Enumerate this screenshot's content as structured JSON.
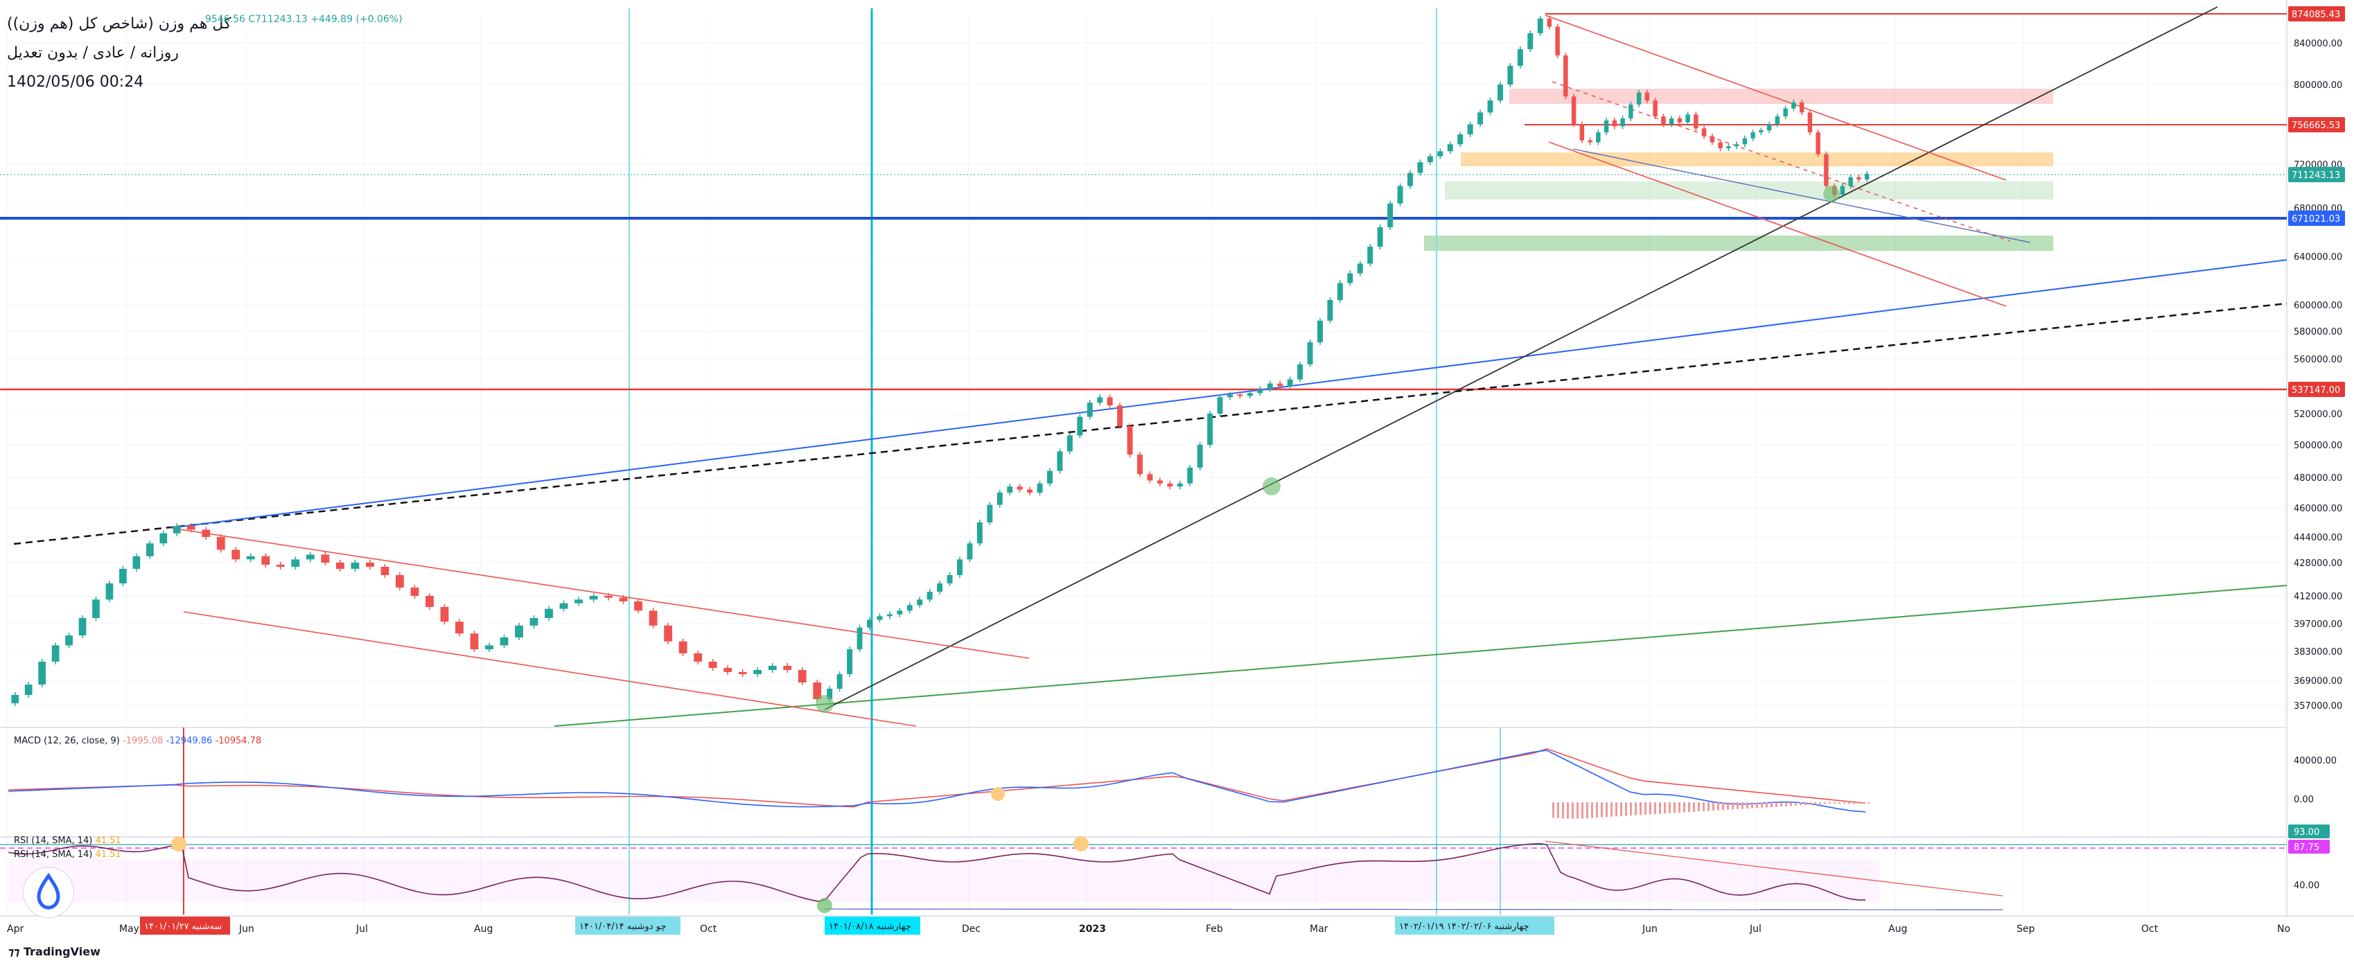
{
  "header": {
    "title": "کل هم وزن (شاخص کل (هم وزن))",
    "subtitle": "روزانه / عادی / بدون تعدیل",
    "datetime": "1402/05/06 00:24",
    "ohlc": "9546.56  C711243.13  +449.89 (+0.06%)"
  },
  "indicators": {
    "macd_label": "MACD (12, 26, close, 9)",
    "macd_v1": "-1995.08",
    "macd_v2": "-12949.86",
    "macd_v3": "-10954.78",
    "rsi1_label": "RSI (14, SMA, 14)",
    "rsi1_value": "41.51",
    "rsi2_label": "RSI (14, SMA, 14)",
    "rsi2_value": "41.51"
  },
  "brand": "TradingView",
  "colors": {
    "up": "#26a69a",
    "down": "#ef5350",
    "blue_line": "#2962ff",
    "red_line": "#e53935",
    "green_line": "#43a047",
    "cyan_line": "#00bcd4"
  },
  "chart_data": {
    "type": "candlestick",
    "title": "کل هم وزن (شاخص کل (هم وزن))",
    "x_tick_labels": [
      "Apr",
      "May",
      "Jun",
      "Jul",
      "Aug",
      "Oct",
      "Dec",
      "2023",
      "Feb",
      "Mar",
      "Jun",
      "Jul",
      "Aug",
      "Sep",
      "Oct",
      "No"
    ],
    "y_tick_labels": [
      "840000.00",
      "800000.00",
      "720000.00",
      "680000.00",
      "640000.00",
      "600000.00",
      "580000.00",
      "560000.00",
      "520000.00",
      "500000.00",
      "480000.00",
      "460000.00",
      "444000.00",
      "428000.00",
      "412000.00",
      "397000.00",
      "383000.00",
      "369000.00",
      "357000.00"
    ],
    "price_badges": [
      {
        "label": "874085.43",
        "color": "#e53935"
      },
      {
        "label": "756665.53",
        "color": "#e53935"
      },
      {
        "label": "711243.13",
        "color": "#26a69a"
      },
      {
        "label": "671021.03",
        "color": "#2962ff"
      },
      {
        "label": "537147.00",
        "color": "#e53935"
      }
    ],
    "macd_ticks": [
      "40000.00",
      "0.00"
    ],
    "rsi_badges": [
      {
        "label": "93.00",
        "color": "#26a69a"
      },
      {
        "label": "87.75",
        "color": "#e040fb"
      }
    ],
    "rsi_ticks": [
      "40.00"
    ],
    "date_badges": [
      {
        "label": "سه‌شنبه ۱۴۰۱/۰۱/۲۷",
        "color": "#e53935"
      },
      {
        "label": "چو  دوشنبه ۱۴۰۱/۰۴/۱۴",
        "color": "#80deea"
      },
      {
        "label": "چهارشنبه ۱۴۰۱/۰۸/۱۸",
        "color": "#00e5ff"
      },
      {
        "label": "چهارشنبه ۱۴۰۲/۰۲/۰۶  ۱۴۰۲/۰۱/۱۹",
        "color": "#80deea"
      }
    ],
    "series": [
      {
        "y": [
          362000,
          367000,
          378000,
          386000,
          391000,
          400000,
          410000,
          418000,
          425000,
          432000,
          440000,
          446000,
          450000
        ]
      },
      {
        "y": [
          448000,
          444000,
          436000,
          430000,
          432000,
          427000,
          426000,
          430000,
          433000,
          428000,
          425000,
          428000,
          426000,
          422000,
          416000,
          412000,
          406000,
          398000,
          392000,
          384000,
          386000,
          390000,
          396000,
          400000,
          405000,
          408000,
          410000,
          412000,
          411000,
          409000,
          404000,
          396000,
          388000,
          382000,
          378000,
          375000,
          373000,
          372000,
          374000,
          376000,
          374000,
          368000,
          360000
        ]
      },
      {
        "y": [
          365000,
          372000,
          384000,
          395000,
          399000,
          401000,
          402000,
          404000,
          407000,
          410000,
          414000,
          418000,
          422000,
          430000,
          440000,
          452000,
          462000,
          470000,
          474000,
          472000,
          470000,
          476000,
          484000,
          496000,
          506000,
          518000,
          528000,
          532000,
          526000,
          512000,
          494000,
          482000,
          478000,
          476000,
          474000,
          476000,
          486000,
          500000,
          520000,
          532000,
          534000,
          533000,
          535000,
          538000,
          542000,
          540000,
          545000,
          556000,
          572000,
          588000,
          604000,
          618000,
          626000,
          634000,
          648000,
          664000,
          684000,
          700000,
          712000,
          722000,
          728000,
          733000,
          740000,
          750000,
          760000,
          772000,
          784000,
          800000,
          818000,
          834000,
          852000,
          870000
        ]
      },
      {
        "y": [
          860000,
          828000,
          788000,
          760000,
          744000,
          742000,
          752000,
          764000,
          758000,
          766000,
          780000,
          792000,
          784000,
          768000,
          760000,
          766000,
          762000,
          770000,
          756000,
          748000,
          742000,
          736000,
          738000,
          740000,
          746000,
          752000,
          754000,
          760000,
          768000,
          776000,
          782000,
          772000,
          752000,
          730000,
          700000,
          692000,
          700000,
          708000,
          706000,
          711243
        ]
      }
    ]
  }
}
